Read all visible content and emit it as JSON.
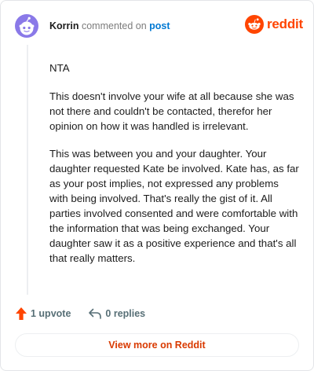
{
  "header": {
    "username": "Korrin",
    "commented_on": "commented on",
    "post_link": "post",
    "brand": "reddit"
  },
  "comment": {
    "paragraphs": [
      "NTA",
      "This doesn't involve your wife at all because she was not there and couldn't be contacted, therefor her opinion on how it was handled is irrelevant.",
      "This was between you and your daughter. Your daughter requested Kate be involved. Kate has, as far as your post implies, not expressed any problems with being involved. That's really the gist of it. All parties involved consented and were comfortable with the information that was being exchanged. Your daughter saw it as a positive experience and that's all that really matters."
    ]
  },
  "actions": {
    "upvotes": "1 upvote",
    "replies": "0 replies"
  },
  "view_more_label": "View more on Reddit",
  "colors": {
    "brand_orange": "#ff4500",
    "link_blue": "#0079d3",
    "view_more_text": "#d93a00",
    "avatar_purple": "#8a79e8"
  },
  "icons": [
    "avatar-icon",
    "reddit-logo-icon",
    "upvote-arrow-icon",
    "reply-arrow-icon"
  ]
}
